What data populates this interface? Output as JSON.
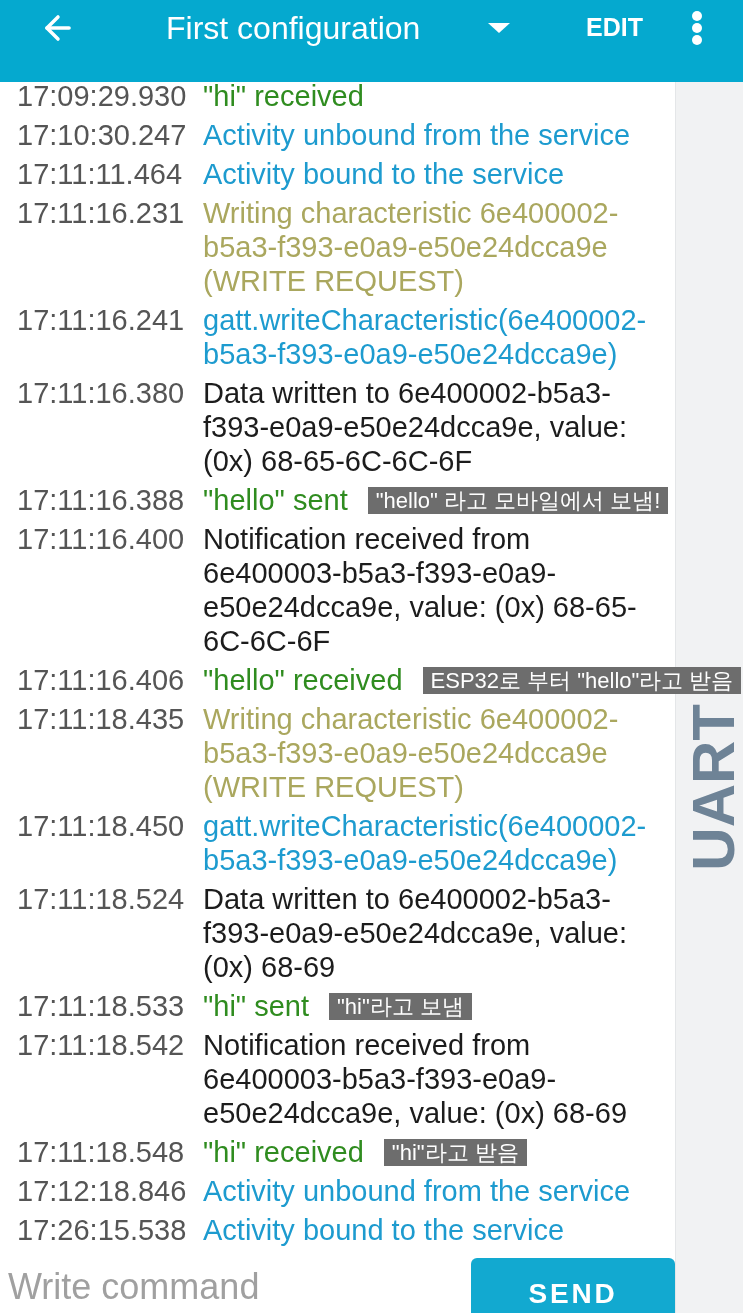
{
  "toolbar": {
    "title": "First configuration",
    "action": "EDIT"
  },
  "log": [
    {
      "time": "17:09:29.930",
      "message": "\"hi\" received",
      "kind": "value"
    },
    {
      "time": "17:10:30.247",
      "message": "Activity unbound from the service",
      "kind": "app"
    },
    {
      "time": "17:11:11.464",
      "message": "Activity bound to the service",
      "kind": "app"
    },
    {
      "time": "17:11:16.231",
      "message": "Writing characteristic 6e400002-b5a3-f393-e0a9-e50e24dcca9e (WRITE REQUEST)",
      "kind": "request"
    },
    {
      "time": "17:11:16.241",
      "message": "gatt.writeCharacteristic(6e400002-b5a3-f393-e0a9-e50e24dcca9e)",
      "kind": "app"
    },
    {
      "time": "17:11:16.380",
      "message": "Data written to 6e400002-b5a3-f393-e0a9-e50e24dcca9e, value: (0x) 68-65-6C-6C-6F",
      "kind": "data"
    },
    {
      "time": "17:11:16.388",
      "message": "\"hello\" sent",
      "kind": "value",
      "note": "\"hello\" 라고 모바일에서 보냄!"
    },
    {
      "time": "17:11:16.400",
      "message": "Notification received from 6e400003-b5a3-f393-e0a9-e50e24dcca9e, value: (0x) 68-65-6C-6C-6F",
      "kind": "data"
    },
    {
      "time": "17:11:16.406",
      "message": "\"hello\" received",
      "kind": "value",
      "note": "ESP32로 부터 \"hello\"라고 받음"
    },
    {
      "time": "17:11:18.435",
      "message": "Writing characteristic 6e400002-b5a3-f393-e0a9-e50e24dcca9e (WRITE REQUEST)",
      "kind": "request"
    },
    {
      "time": "17:11:18.450",
      "message": "gatt.writeCharacteristic(6e400002-b5a3-f393-e0a9-e50e24dcca9e)",
      "kind": "app"
    },
    {
      "time": "17:11:18.524",
      "message": "Data written to 6e400002-b5a3-f393-e0a9-e50e24dcca9e, value: (0x) 68-69",
      "kind": "data"
    },
    {
      "time": "17:11:18.533",
      "message": "\"hi\" sent",
      "kind": "value",
      "note": "\"hi\"라고 보냄"
    },
    {
      "time": "17:11:18.542",
      "message": "Notification received from 6e400003-b5a3-f393-e0a9-e50e24dcca9e, value: (0x) 68-69",
      "kind": "data"
    },
    {
      "time": "17:11:18.548",
      "message": "\"hi\" received",
      "kind": "value",
      "note": "\"hi\"라고 받음"
    },
    {
      "time": "17:12:18.846",
      "message": "Activity unbound from the service",
      "kind": "app"
    },
    {
      "time": "17:26:15.538",
      "message": "Activity bound to the service",
      "kind": "app"
    }
  ],
  "side_tab": {
    "label": "UART"
  },
  "composer": {
    "placeholder": "Write command",
    "button": "SEND"
  }
}
